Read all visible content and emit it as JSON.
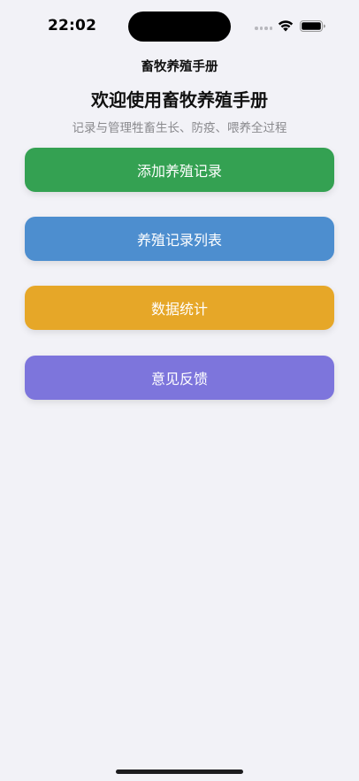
{
  "status_bar": {
    "time": "22:02"
  },
  "nav": {
    "title": "畜牧养殖手册"
  },
  "header": {
    "welcome": "欢迎使用畜牧养殖手册",
    "subtitle": "记录与管理牲畜生长、防疫、喂养全过程"
  },
  "actions": [
    {
      "label": "添加养殖记录",
      "color": "#34a152"
    },
    {
      "label": "养殖记录列表",
      "color": "#4d8ecf"
    },
    {
      "label": "数据统计",
      "color": "#e6a728"
    },
    {
      "label": "意见反馈",
      "color": "#7d75dc"
    }
  ],
  "icons": {
    "wifi": "wifi-icon",
    "battery": "battery-icon",
    "signal": "signal-icon"
  }
}
